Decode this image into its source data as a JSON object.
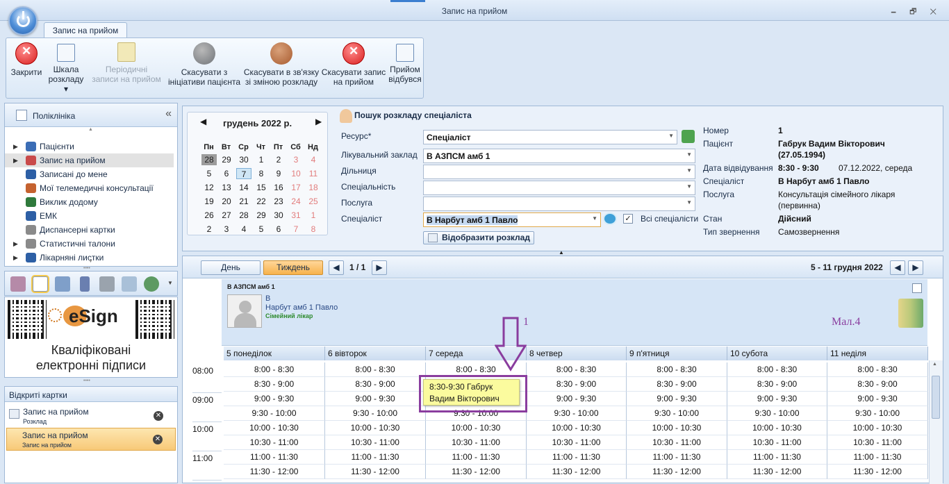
{
  "window": {
    "title": "Запис на прийом",
    "controls": "🗕 🗗 ✕"
  },
  "ribbon": {
    "tab": "Запис на прийом",
    "buttons": [
      {
        "label": "Закрити",
        "icon": "close-red-icon",
        "enabled": true
      },
      {
        "label": "Шкала\nрозкладу ▾",
        "icon": "scale-icon",
        "enabled": true
      },
      {
        "label": "Періодичні\nзаписи на прийом",
        "icon": "periodic-icon",
        "enabled": false
      },
      {
        "label": "Скасувати з\nініціативи пацієнта",
        "icon": "cancel-patient-icon",
        "enabled": true
      },
      {
        "label": "Скасувати в зв'язку\nзі зміною розкладу",
        "icon": "cancel-schedule-icon",
        "enabled": true
      },
      {
        "label": "Скасувати запис\nна прийом",
        "icon": "cancel-red-icon",
        "enabled": true
      },
      {
        "label": "Прийом\nвідбувся",
        "icon": "done-icon",
        "enabled": true
      }
    ]
  },
  "sidebar": {
    "title": "Поліклініка",
    "collapse": "«",
    "items": [
      {
        "label": "Пацієнти",
        "expand": true,
        "color": "#3b6db5"
      },
      {
        "label": "Запис на прийом",
        "expand": true,
        "selected": true,
        "color": "#c94a4a"
      },
      {
        "label": "Записані до мене",
        "expand": false,
        "color": "#2d5fa5"
      },
      {
        "label": "Мої телемедичні консультації",
        "expand": false,
        "color": "#c5622f"
      },
      {
        "label": "Виклик додому",
        "expand": false,
        "color": "#2f7a3c"
      },
      {
        "label": "ЕМК",
        "expand": false,
        "color": "#2d5fa5"
      },
      {
        "label": "Диспансерні картки",
        "expand": false,
        "color": "#8a8a8a"
      },
      {
        "label": "Статистичні талони",
        "expand": true,
        "color": "#8a8a8a"
      },
      {
        "label": "Лікарняні листки",
        "expand": true,
        "color": "#2d5fa5"
      }
    ]
  },
  "esign": {
    "brand": "eSign",
    "caption_line1": "Кваліфіковані",
    "caption_line2": "електронні підписи"
  },
  "open_cards": {
    "title": "Відкриті картки",
    "items": [
      {
        "title": "Запис на прийом",
        "subtitle": "Розклад",
        "active": false
      },
      {
        "title": "Запис на прийом",
        "subtitle": "Запис на прийом",
        "active": true
      }
    ]
  },
  "calendar": {
    "month": "грудень 2022 р.",
    "weekdays": [
      "Пн",
      "Вт",
      "Ср",
      "Чт",
      "Пт",
      "Сб",
      "Нд"
    ],
    "weeks": [
      [
        "28",
        "29",
        "30",
        "1",
        "2",
        "3",
        "4"
      ],
      [
        "5",
        "6",
        "7",
        "8",
        "9",
        "10",
        "11"
      ],
      [
        "12",
        "13",
        "14",
        "15",
        "16",
        "17",
        "18"
      ],
      [
        "19",
        "20",
        "21",
        "22",
        "23",
        "24",
        "25"
      ],
      [
        "26",
        "27",
        "28",
        "29",
        "30",
        "31",
        "1"
      ],
      [
        "2",
        "3",
        "4",
        "5",
        "6",
        "7",
        "8"
      ]
    ],
    "today": "7"
  },
  "search": {
    "title": "Пошук розкладу спеціаліста",
    "fields": [
      {
        "label": "Ресурс*",
        "value": "Спеціаліст"
      },
      {
        "label": "Лікувальний заклад",
        "value": "В АЗПСМ амб 1"
      },
      {
        "label": "Дільниця",
        "value": ""
      },
      {
        "label": "Спеціальність",
        "value": ""
      },
      {
        "label": "Послуга",
        "value": ""
      },
      {
        "label": "Спеціаліст",
        "value": "В Нарбут амб 1 Павло"
      }
    ],
    "all_specialists": "Всі спеціалісти",
    "show_button": "Відобразити розклад"
  },
  "info": [
    {
      "label": "Номер",
      "value": "1",
      "bold": true
    },
    {
      "label": "Пацієнт",
      "value": "Габрук Вадим Вікторович",
      "bold": true
    },
    {
      "label": "",
      "value": "(27.05.1994)",
      "bold": true
    },
    {
      "label": "Дата відвідування",
      "value": "8:30 - 9:30",
      "bold": true,
      "extra": "07.12.2022, середа"
    },
    {
      "label": "Спеціаліст",
      "value": "В Нарбут амб 1 Павло",
      "bold": true
    },
    {
      "label": "Послуга",
      "value": "Консультація сімейного лікаря",
      "bold": false
    },
    {
      "label": "",
      "value": "(первинна)",
      "bold": false
    },
    {
      "label": "Стан",
      "value": "Дійсний",
      "bold": true
    },
    {
      "label": "Тип звернення",
      "value": "Самозвернення",
      "bold": false
    }
  ],
  "schedule": {
    "view_day": "День",
    "view_week": "Тиждень",
    "pager": "1 / 1",
    "range": "5 - 11 грудня 2022",
    "clinic": "В АЗПСМ амб 1",
    "doc_line1": "В",
    "doc_line2": "Нарбут амб 1 Павло",
    "doc_role": "Сімейний лікар",
    "annotation_num": "1",
    "annotation_mal": "Мал.4",
    "days": [
      "5 понеділок",
      "6 вівторок",
      "7 середа",
      "8 четвер",
      "9 п'ятниця",
      "10 субота",
      "11 неділя"
    ],
    "hours": [
      "08:00",
      "09:00",
      "10:00",
      "11:00"
    ],
    "slots": [
      "8:00 - 8:30",
      "8:30 - 9:00",
      "9:00 - 9:30",
      "9:30 - 10:00",
      "10:00 - 10:30",
      "10:30 - 11:00",
      "11:00 - 11:30",
      "11:30 - 12:00"
    ],
    "appointment_line1": "8:30-9:30 Габрук",
    "appointment_line2": "Вадим Вікторович"
  }
}
